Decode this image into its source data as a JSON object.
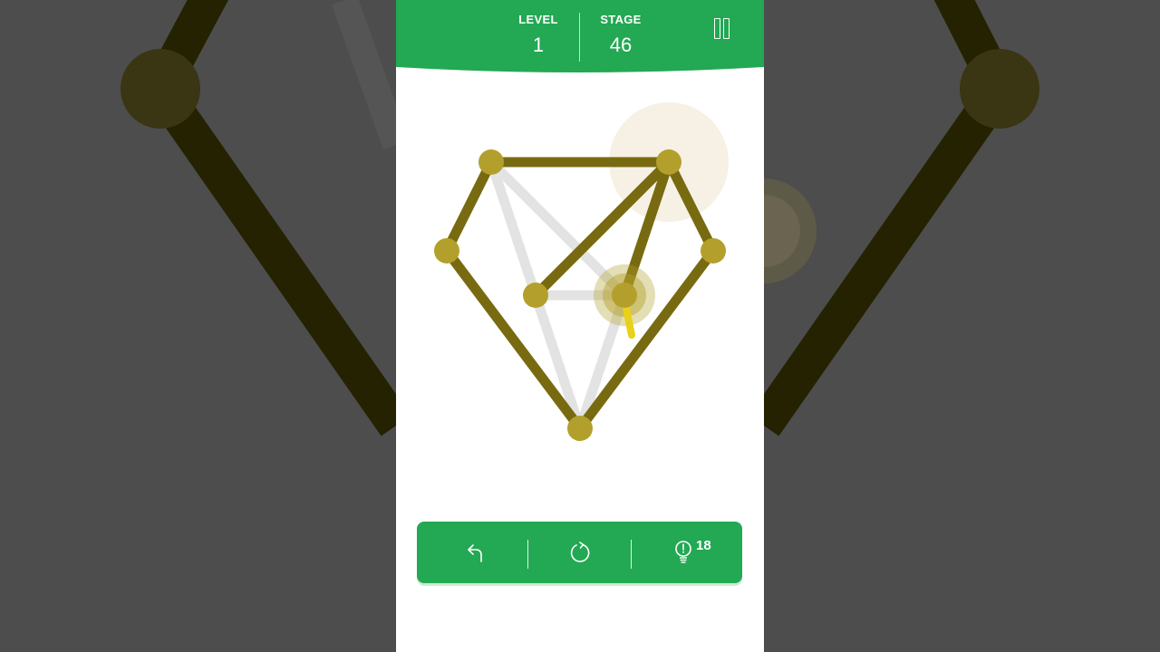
{
  "header": {
    "level_label": "LEVEL",
    "level_value": "1",
    "stage_label": "STAGE",
    "stage_value": "46",
    "pause_icon": "pause-icon"
  },
  "toolbar": {
    "undo_icon": "undo-icon",
    "restart_icon": "restart-icon",
    "hint_icon": "lightbulb-icon",
    "hint_count": "18"
  },
  "colors": {
    "header_green": "#23a853",
    "drawn_line": "#786a10",
    "undrawn_line": "#e3e3e3",
    "node": "#b3a02c",
    "background": "#4d4d4d"
  },
  "puzzle": {
    "nodes": 7,
    "edges_total": 12,
    "edges_drawn": 8
  }
}
